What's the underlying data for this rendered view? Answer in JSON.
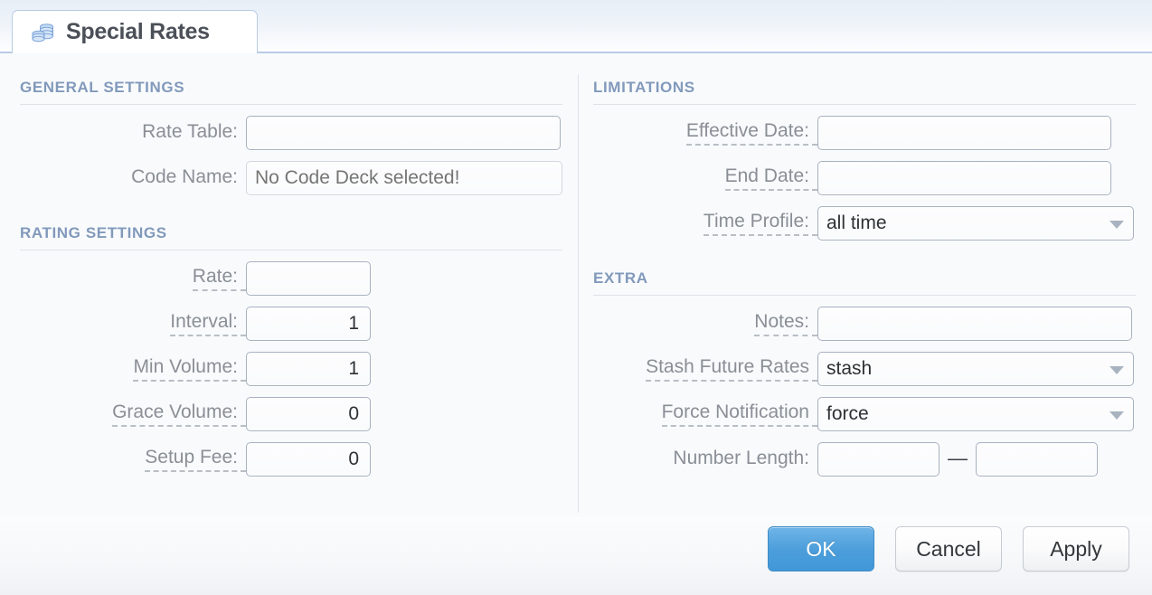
{
  "tab": {
    "label": "Special Rates",
    "icon": "coin-stack-icon"
  },
  "sections": {
    "general": {
      "title": "GENERAL SETTINGS"
    },
    "rating": {
      "title": "RATING SETTINGS"
    },
    "limitations": {
      "title": "LIMITATIONS"
    },
    "extra": {
      "title": "EXTRA"
    }
  },
  "general": {
    "rate_table": {
      "label": "Rate Table:",
      "value": "",
      "placeholder": ""
    },
    "code_name": {
      "label": "Code Name:",
      "value": "",
      "placeholder": "No Code Deck selected!"
    }
  },
  "rating": {
    "rate": {
      "label": "Rate:",
      "value": ""
    },
    "interval": {
      "label": "Interval:",
      "value": "1"
    },
    "min_volume": {
      "label": "Min Volume:",
      "value": "1"
    },
    "grace_volume": {
      "label": "Grace Volume:",
      "value": "0"
    },
    "setup_fee": {
      "label": "Setup Fee:",
      "value": "0"
    }
  },
  "limitations": {
    "effective_date": {
      "label": "Effective Date:",
      "value": ""
    },
    "end_date": {
      "label": "End Date:",
      "value": ""
    },
    "time_profile": {
      "label": "Time Profile:",
      "value": "all time"
    }
  },
  "extra": {
    "notes": {
      "label": "Notes:",
      "value": ""
    },
    "stash_future_rates": {
      "label": "Stash Future Rates",
      "value": "stash"
    },
    "force_notification": {
      "label": "Force Notification",
      "value": "force"
    },
    "number_length": {
      "label": "Number Length:",
      "min": "",
      "max": "",
      "separator": "—"
    }
  },
  "buttons": {
    "ok": "OK",
    "cancel": "Cancel",
    "apply": "Apply"
  },
  "colors": {
    "accent": "#4c9edb",
    "section_heading": "#8199bb",
    "label": "#8a8f96",
    "field_border": "#a7b2c0",
    "tab_border": "#b9cce4"
  }
}
